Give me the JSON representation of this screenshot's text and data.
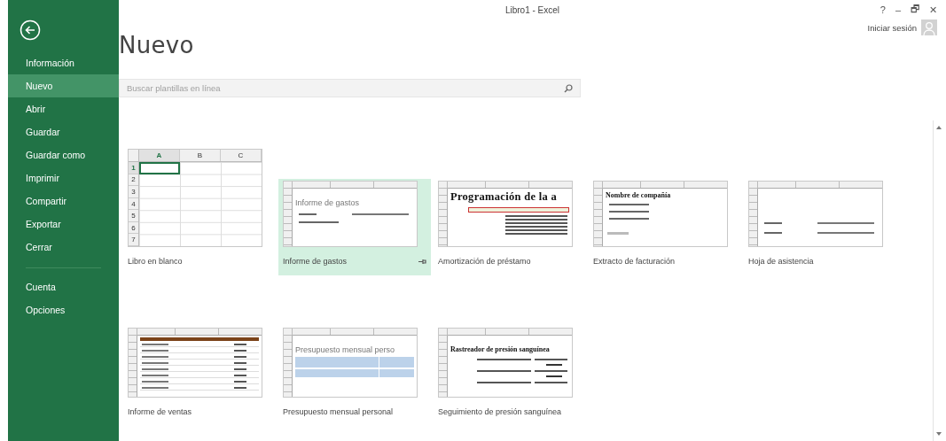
{
  "window": {
    "title": "Libro1 - Excel",
    "controls": [
      "?",
      "–",
      "🗗",
      "✕"
    ],
    "sign_in": "Iniciar sesión"
  },
  "sidebar": {
    "items": [
      {
        "label": "Información",
        "selected": false,
        "divider_above": false
      },
      {
        "label": "Nuevo",
        "selected": true,
        "divider_above": false
      },
      {
        "label": "Abrir",
        "selected": false,
        "divider_above": false
      },
      {
        "label": "Guardar",
        "selected": false,
        "divider_above": false
      },
      {
        "label": "Guardar como",
        "selected": false,
        "divider_above": false
      },
      {
        "label": "Imprimir",
        "selected": false,
        "divider_above": false
      },
      {
        "label": "Compartir",
        "selected": false,
        "divider_above": false
      },
      {
        "label": "Exportar",
        "selected": false,
        "divider_above": false
      },
      {
        "label": "Cerrar",
        "selected": false,
        "divider_above": false
      },
      {
        "label": "Cuenta",
        "selected": false,
        "divider_above": true
      },
      {
        "label": "Opciones",
        "selected": false,
        "divider_above": false
      }
    ]
  },
  "page": {
    "title": "Nuevo",
    "search": {
      "placeholder": "Buscar plantillas en línea"
    }
  },
  "templates": [
    {
      "name": "Libro en blanco",
      "selected": false,
      "preview": {
        "kind": "blank",
        "columns": [
          "A",
          "B",
          "C"
        ],
        "rows": [
          "1",
          "2",
          "3",
          "4",
          "5",
          "6",
          "7"
        ]
      }
    },
    {
      "name": "Informe de gastos",
      "selected": true,
      "preview": {
        "kind": "sheet",
        "items": [
          {
            "kind": "gap"
          },
          {
            "kind": "heading-light",
            "text": "Informe de gastos"
          },
          {
            "kind": "field"
          },
          {
            "kind": "line"
          }
        ]
      }
    },
    {
      "name": "Amortización de préstamo",
      "selected": false,
      "preview": {
        "kind": "sheet",
        "items": [
          {
            "kind": "heading",
            "text": "Programación de la a"
          },
          {
            "kind": "band"
          },
          {
            "kind": "line-right"
          },
          {
            "kind": "line-right"
          },
          {
            "kind": "line-right"
          },
          {
            "kind": "line-right"
          },
          {
            "kind": "line-right"
          },
          {
            "kind": "line-right"
          }
        ]
      }
    },
    {
      "name": "Extracto de facturación",
      "selected": false,
      "preview": {
        "kind": "sheet",
        "items": [
          {
            "kind": "heading-bold",
            "text": "Nombre de compañía"
          },
          {
            "kind": "line"
          },
          {
            "kind": "line"
          },
          {
            "kind": "line"
          },
          {
            "kind": "gap"
          },
          {
            "kind": "faint"
          }
        ]
      }
    },
    {
      "name": "Hoja de asistencia",
      "selected": false,
      "preview": {
        "kind": "sheet",
        "items": [
          {
            "kind": "gap"
          },
          {
            "kind": "gap"
          },
          {
            "kind": "gap"
          },
          {
            "kind": "gap"
          },
          {
            "kind": "field"
          },
          {
            "kind": "field"
          }
        ]
      }
    },
    {
      "name": "Informe de ventas",
      "selected": false,
      "preview": {
        "kind": "sheet",
        "items": [
          {
            "kind": "header-row"
          },
          {
            "kind": "row"
          },
          {
            "kind": "row"
          },
          {
            "kind": "row"
          },
          {
            "kind": "row"
          },
          {
            "kind": "row"
          },
          {
            "kind": "row"
          },
          {
            "kind": "row"
          },
          {
            "kind": "row"
          }
        ]
      }
    },
    {
      "name": "Presupuesto mensual personal",
      "selected": false,
      "preview": {
        "kind": "sheet",
        "items": [
          {
            "kind": "gap"
          },
          {
            "kind": "heading-light",
            "text": "Presupuesto mensual perso"
          },
          {
            "kind": "group"
          },
          {
            "kind": "group-short"
          }
        ]
      }
    },
    {
      "name": "Seguimiento de presión sanguínea",
      "selected": false,
      "preview": {
        "kind": "sheet",
        "items": [
          {
            "kind": "gap"
          },
          {
            "kind": "heading-bold",
            "text": "Rastreador de presión sanguínea"
          },
          {
            "kind": "field-right"
          },
          {
            "kind": "caption"
          },
          {
            "kind": "field-right"
          },
          {
            "kind": "caption"
          },
          {
            "kind": "field-right"
          }
        ]
      }
    }
  ]
}
